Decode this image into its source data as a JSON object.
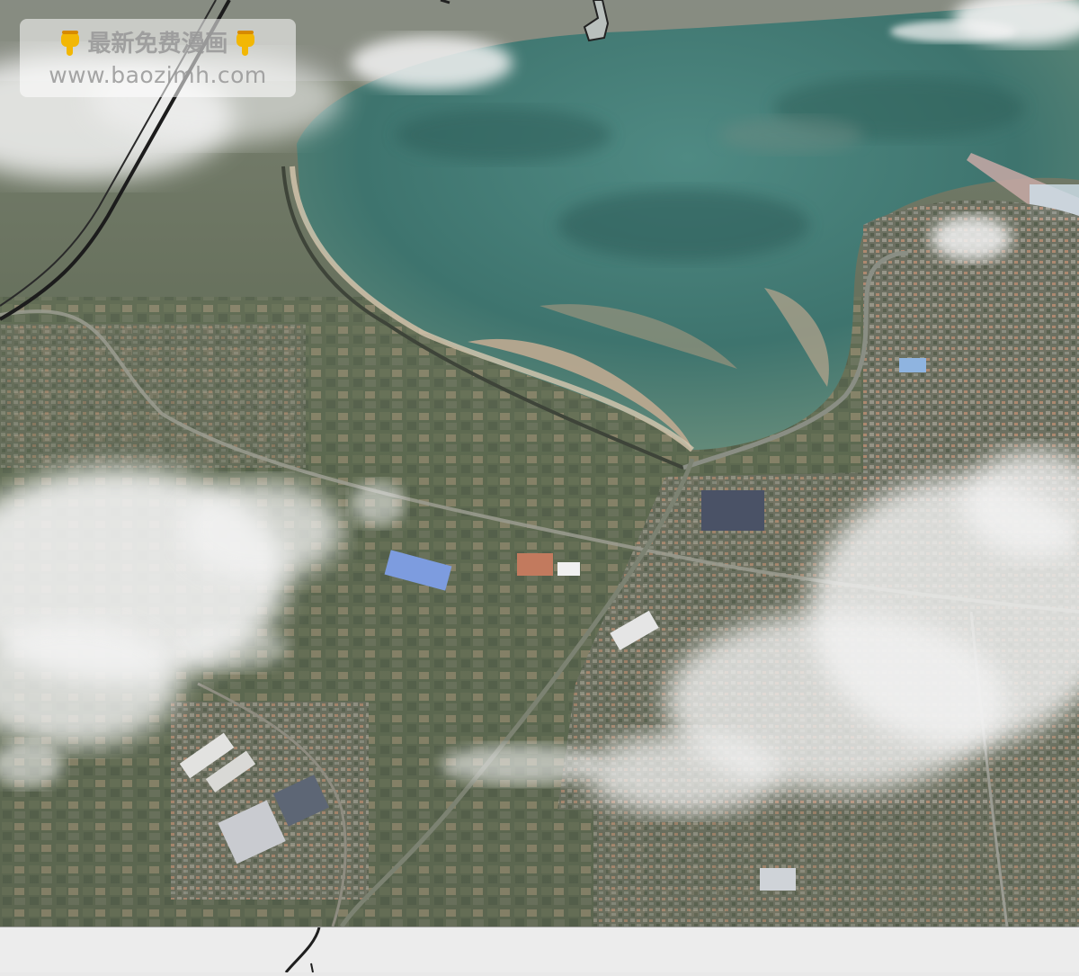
{
  "watermark": {
    "line1": "最新免费漫画",
    "line2": "www.baozimh.com",
    "icon": "pointing-down-hand-icon"
  },
  "colors": {
    "sea": "#3f7a74",
    "land": "#5e6a55",
    "sand": "#c9b397",
    "cloud": "#f2f2f2",
    "panel_border": "#222222",
    "gutter": "#ececec"
  }
}
